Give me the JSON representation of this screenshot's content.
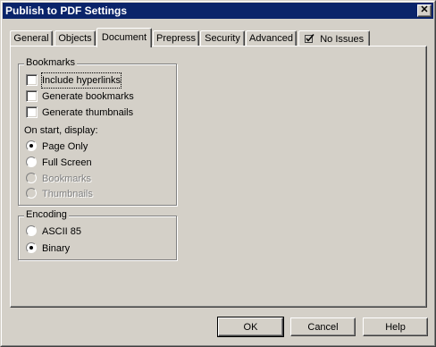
{
  "window": {
    "title": "Publish to PDF Settings",
    "close_glyph": "✕"
  },
  "tabs": [
    {
      "label": "General"
    },
    {
      "label": "Objects"
    },
    {
      "label": "Document"
    },
    {
      "label": "Prepress"
    },
    {
      "label": "Security"
    },
    {
      "label": "Advanced"
    },
    {
      "label": "No Issues",
      "icon": "check-icon"
    }
  ],
  "active_tab": "Document",
  "bookmarks": {
    "title": "Bookmarks",
    "checkboxes": [
      {
        "label": "Include hyperlinks",
        "checked": false
      },
      {
        "label": "Generate bookmarks",
        "checked": false
      },
      {
        "label": "Generate thumbnails",
        "checked": false
      }
    ],
    "on_start_label": "On start, display:",
    "on_start_options": [
      {
        "label": "Page Only",
        "selected": true,
        "enabled": true
      },
      {
        "label": "Full Screen",
        "selected": false,
        "enabled": true
      },
      {
        "label": "Bookmarks",
        "selected": false,
        "enabled": false
      },
      {
        "label": "Thumbnails",
        "selected": false,
        "enabled": false
      }
    ]
  },
  "encoding": {
    "title": "Encoding",
    "options": [
      {
        "label": "ASCII 85",
        "selected": false
      },
      {
        "label": "Binary",
        "selected": true
      }
    ]
  },
  "buttons": {
    "ok": "OK",
    "cancel": "Cancel",
    "help": "Help"
  },
  "colors": {
    "face": "#d4d0c8",
    "titlebar": "#0a246a",
    "disabled_text": "#808080"
  }
}
